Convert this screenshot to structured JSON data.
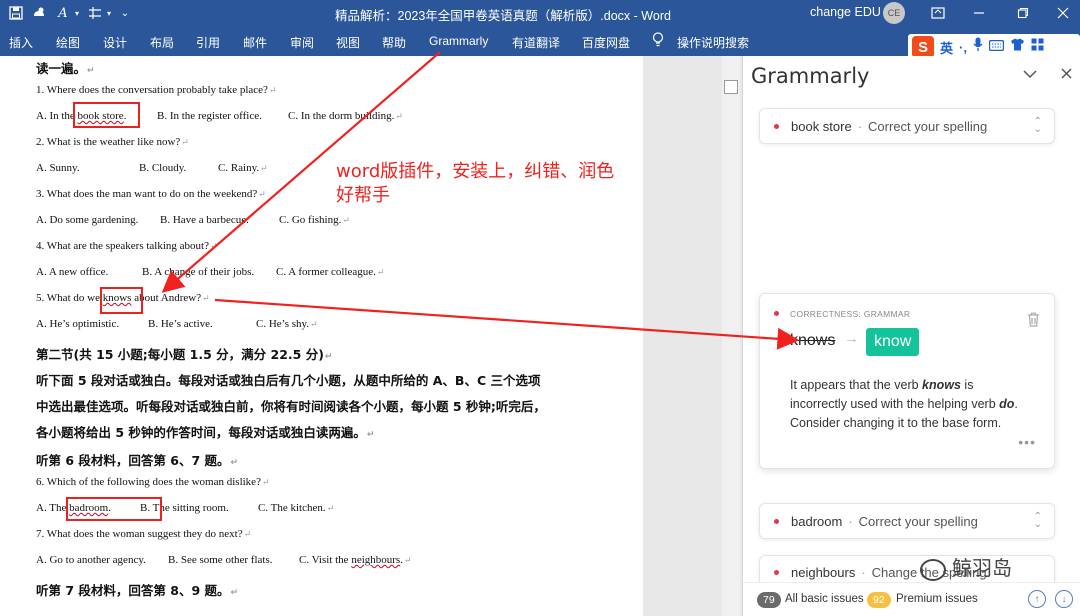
{
  "titlebar": {
    "title": "精品解析：2023年全国甲卷英语真题（解析版）.docx  -  Word",
    "account_name": "change EDU",
    "account_initials": "CE"
  },
  "ribbon": {
    "tabs": [
      "插入",
      "绘图",
      "设计",
      "布局",
      "引用",
      "邮件",
      "审阅",
      "视图",
      "帮助",
      "Grammarly",
      "有道翻译",
      "百度网盘",
      "操作说明搜索"
    ]
  },
  "ime": {
    "logo": "S",
    "lang": "英",
    "punct": "·,"
  },
  "document": {
    "lines": [
      {
        "text": "读一遍。",
        "bold": true
      },
      {
        "text": "1. Where does the conversation probably take place?"
      },
      {
        "segs": [
          "A. In the ",
          {
            "t": "book store",
            "err": true
          },
          ".",
          "B. In the register office.",
          "C. In the dorm building."
        ]
      },
      {
        "text": "2. What is the weather like now?"
      },
      {
        "segs": [
          "A. Sunny.",
          "B. Cloudy.",
          "C. Rainy."
        ]
      },
      {
        "text": "3. What does the man want to do on the weekend?"
      },
      {
        "segs": [
          "A. Do some gardening.",
          "B. Have a barbecue.",
          "C. Go fishing."
        ]
      },
      {
        "text": "4. What are the speakers talking about?"
      },
      {
        "segs": [
          "A. A new office.",
          "B. A change of their jobs.",
          "C. A former colleague."
        ]
      },
      {
        "segs": [
          "5. What do we ",
          {
            "t": "knows",
            "err": true
          },
          " about Andrew?"
        ]
      },
      {
        "segs": [
          "A. He’s optimistic.",
          "B. He’s active.",
          "C. He’s shy."
        ]
      },
      {
        "text": "第二节(共 15 小题;每小题 1.5 分，满分 22.5 分)",
        "bold": true
      },
      {
        "text": "听下面 5 段对话或独白。每段对话或独白后有几个小题，从题中所给的 A、B、C 三个选项",
        "bold": true,
        "noret": true
      },
      {
        "text": "中选出最佳选项。听每段对话或独白前，你将有时间阅读各个小题，每小题 5 秒钟;听完后，",
        "bold": true,
        "noret": true
      },
      {
        "text": "各小题将给出 5 秒钟的作答时间，每段对话或独白读两遍。",
        "bold": true
      },
      {
        "text": "听第 6 段材料，回答第 6、7 题。",
        "bold": true
      },
      {
        "text": "6. Which of the following does the woman dislike?"
      },
      {
        "segs": [
          "A. The ",
          {
            "t": "badroom",
            "err": true
          },
          ".",
          "B. The sitting room.",
          "C. The kitchen."
        ]
      },
      {
        "text": "7. What does the woman suggest they do next?"
      },
      {
        "segs": [
          "A. Go to another agency.",
          "B. See some other flats.",
          "C. Visit the ",
          {
            "t": "neighbours",
            "err": true
          },
          "."
        ]
      },
      {
        "text": "听第 7 段材料，回答第 8、9 题。",
        "bold": true
      }
    ],
    "annotation": [
      "word版插件，安装上，纠错、润色",
      "好帮手"
    ]
  },
  "grammarly": {
    "title": "Grammarly",
    "cards": [
      {
        "keyword": "book store",
        "hint": "Correct your spelling"
      },
      {
        "keyword": "badroom",
        "hint": "Correct your spelling"
      },
      {
        "keyword": "neighbours",
        "hint": "Change the spelling"
      }
    ],
    "expanded": {
      "category": "CORRECTNESS: GRAMMAR",
      "old": "knows",
      "new": "know",
      "explanation_parts": [
        "It appears that the verb ",
        "knows",
        " is incorrectly used with the helping verb ",
        "do",
        ". Consider changing it to the base form."
      ]
    },
    "footer": {
      "basic_count": "79",
      "basic_label": "All basic issues",
      "premium_count": "92",
      "premium_label": "Premium issues"
    }
  },
  "watermark": "鲸羽岛",
  "colors": {
    "word_blue": "#2b579a",
    "annotation_red": "#f1211e",
    "grammarly_green": "#15c39a",
    "error_dot": "#e0394a",
    "premium_badge": "#f6c142",
    "basic_badge": "#6b6b6b"
  }
}
